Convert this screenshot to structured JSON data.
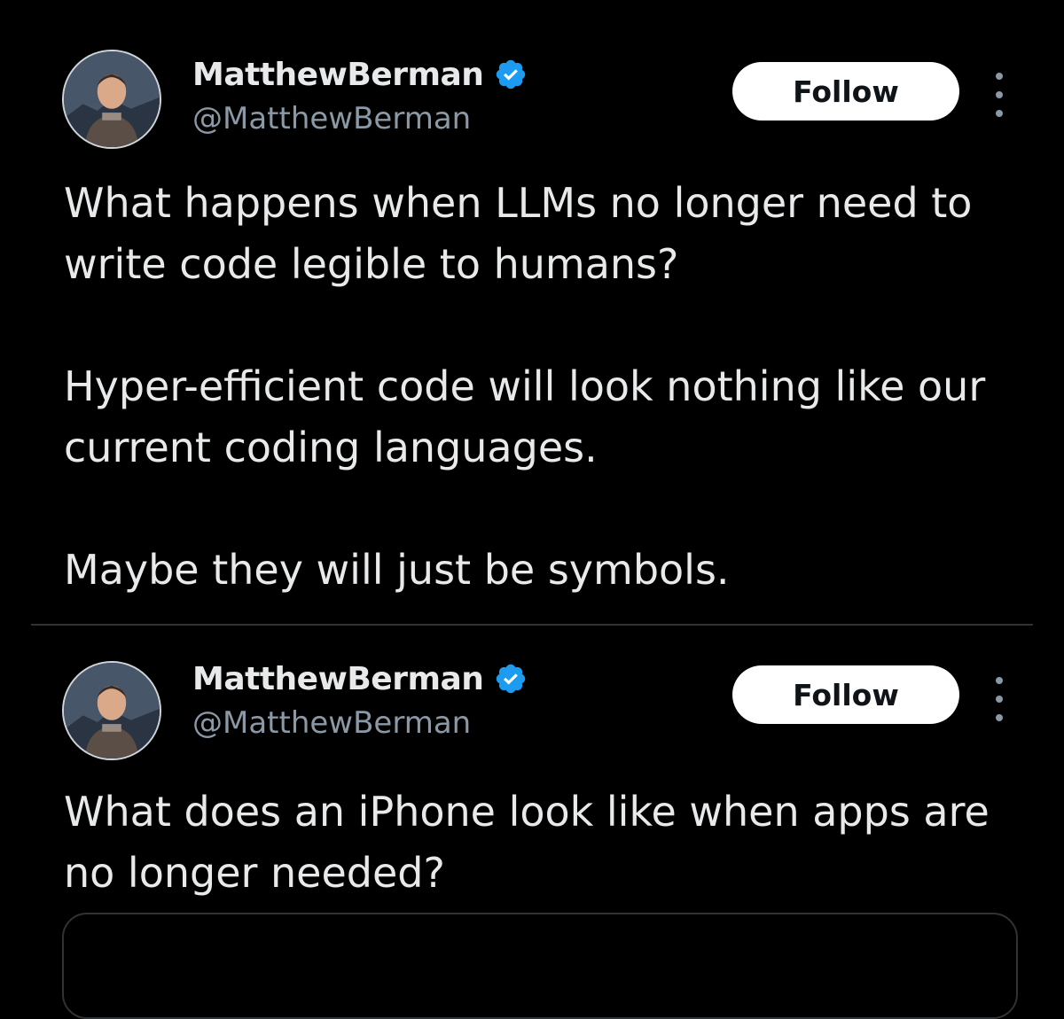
{
  "colors": {
    "background": "#000000",
    "text_primary": "#e7e9ea",
    "text_secondary": "#8b98a5",
    "verified": "#1d9bf0",
    "follow_bg": "#ffffff",
    "follow_text": "#0f1419",
    "divider": "#2f3336"
  },
  "tweets": [
    {
      "author": {
        "display_name": "MatthewBerman",
        "handle": "@MatthewBerman",
        "verified": true,
        "avatar_icon": "avatar-photo"
      },
      "follow_label": "Follow",
      "more_icon": "more-vertical-icon",
      "text_paragraphs": [
        "What happens when LLMs no longer need to write code legible to humans?",
        "Hyper-efficient code will look nothing like our current coding languages.",
        "Maybe they will just be symbols."
      ]
    },
    {
      "author": {
        "display_name": "MatthewBerman",
        "handle": "@MatthewBerman",
        "verified": true,
        "avatar_icon": "avatar-photo"
      },
      "follow_label": "Follow",
      "more_icon": "more-vertical-icon",
      "text_paragraphs": [
        "What does an iPhone look like when apps are no longer needed?"
      ]
    }
  ]
}
